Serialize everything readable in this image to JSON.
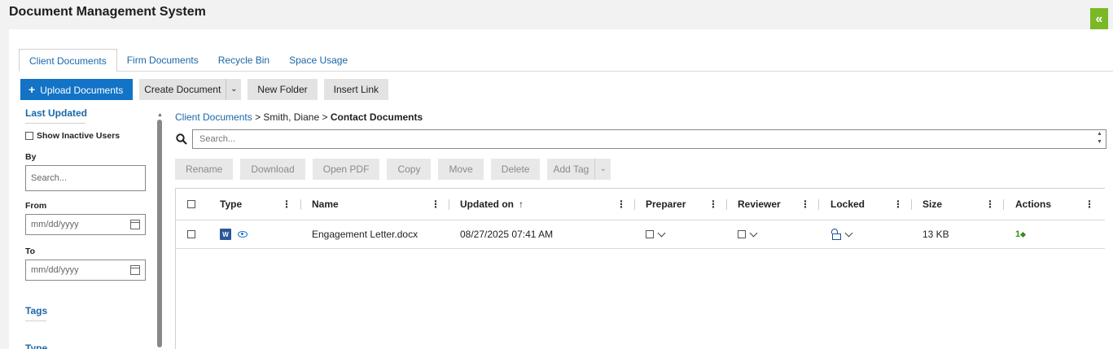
{
  "app": {
    "title": "Document Management System"
  },
  "tabs": [
    {
      "label": "Client Documents"
    },
    {
      "label": "Firm Documents"
    },
    {
      "label": "Recycle Bin"
    },
    {
      "label": "Space Usage"
    }
  ],
  "toolbar": {
    "upload_label": "Upload Documents",
    "create_label": "Create Document",
    "new_folder_label": "New Folder",
    "insert_link_label": "Insert Link"
  },
  "filters": {
    "last_updated": "Last Updated",
    "show_inactive": "Show Inactive Users",
    "by_label": "By",
    "by_placeholder": "Search...",
    "from_label": "From",
    "from_placeholder": "mm/dd/yyyy",
    "to_label": "To",
    "to_placeholder": "mm/dd/yyyy",
    "tags": "Tags",
    "type": "Type"
  },
  "breadcrumb": {
    "root": "Client Documents",
    "sep": ">",
    "client": "Smith, Diane",
    "current": "Contact Documents"
  },
  "search": {
    "placeholder": "Search..."
  },
  "actions": {
    "rename": "Rename",
    "download": "Download",
    "open_pdf": "Open PDF",
    "copy": "Copy",
    "move": "Move",
    "delete": "Delete",
    "add_tag": "Add Tag"
  },
  "grid": {
    "columns": [
      "Type",
      "Name",
      "Updated on",
      "Preparer",
      "Reviewer",
      "Locked",
      "Size",
      "Actions"
    ],
    "sort_indicator": "↑",
    "rows": [
      {
        "name": "Engagement Letter.docx",
        "updated": "08/27/2025 07:41 AM",
        "size": "13 KB",
        "actions_count": "1"
      }
    ]
  },
  "colors": {
    "accent": "#1273c7",
    "collapse": "#7ab826",
    "link": "#1a67a8"
  }
}
